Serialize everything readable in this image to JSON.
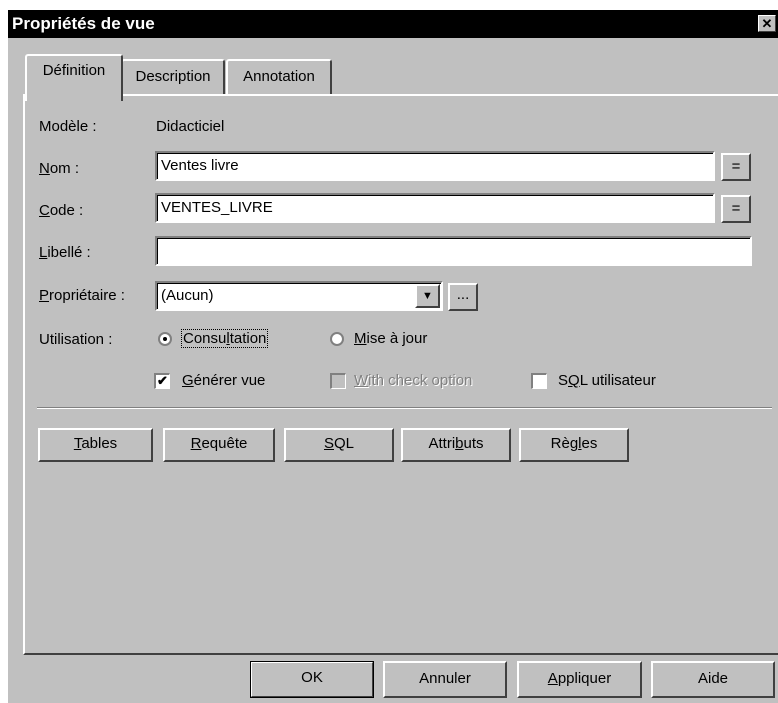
{
  "window": {
    "title": "Propriétés de vue",
    "close_glyph": "✕"
  },
  "tabs": [
    {
      "label": "Définition",
      "active": true
    },
    {
      "label": "Description",
      "active": false
    },
    {
      "label": "Annotation",
      "active": false
    }
  ],
  "form": {
    "modele_label": "Modèle :",
    "modele_value": "Didacticiel",
    "nom_label_key": "N",
    "nom_label_rest": "om :",
    "nom_value": "Ventes livre",
    "code_label_key": "C",
    "code_label_rest": "ode :",
    "code_value": "VENTES_LIVRE",
    "libelle_label_key": "L",
    "libelle_label_rest": "ibellé :",
    "libelle_value": "",
    "proprietaire_label_key": "P",
    "proprietaire_label_rest": "ropriétaire :",
    "proprietaire_value": "(Aucun)",
    "equals_glyph": "=",
    "ellipsis_glyph": "...",
    "dropdown_glyph": "▼",
    "utilisation_label": "Utilisation :",
    "radio_consultation_pre": "Consu",
    "radio_consultation_key": "l",
    "radio_consultation_post": "tation",
    "radio_consultation_checked": true,
    "radio_miseajour_key": "M",
    "radio_miseajour_rest": "ise à jour",
    "radio_miseajour_checked": false,
    "check_generer_key": "G",
    "check_generer_rest": "énérer vue",
    "check_generer_checked": true,
    "check_with_key": "W",
    "check_with_rest": "ith check option",
    "check_with_checked": false,
    "check_with_enabled": false,
    "check_sql_pre": "S",
    "check_sql_key": "Q",
    "check_sql_post": "L utilisateur",
    "check_sql_checked": false,
    "check_glyph": "✔"
  },
  "panel_buttons": {
    "tables_key": "T",
    "tables_rest": "ables",
    "requete_key": "R",
    "requete_rest": "equête",
    "sql_key": "S",
    "sql_rest": "QL",
    "attributs_pre": "Attri",
    "attributs_key": "b",
    "attributs_post": "uts",
    "regles_pre": "Règ",
    "regles_key": "l",
    "regles_post": "es"
  },
  "dialog_buttons": {
    "ok": "OK",
    "annuler": "Annuler",
    "appliquer_key": "A",
    "appliquer_rest": "ppliquer",
    "aide": "Aide"
  }
}
